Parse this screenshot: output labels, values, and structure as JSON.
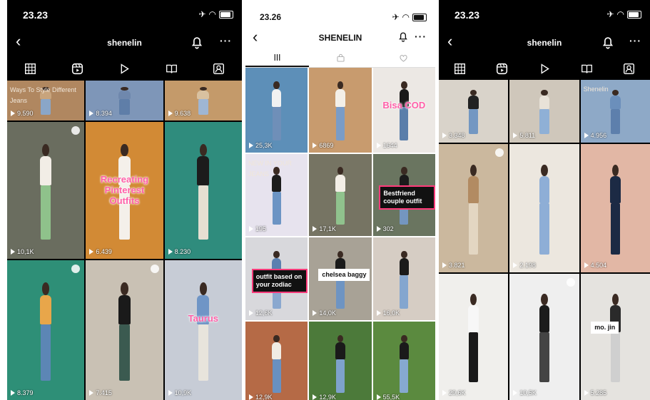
{
  "screens": [
    {
      "theme": "dark",
      "time": "23.23",
      "username": "shenelin",
      "tabs": [
        "grid-icon",
        "reels-icon",
        "play-icon",
        "guide-icon",
        "tagged-icon"
      ],
      "active_tab": 1,
      "tiles": [
        {
          "views": "9.590",
          "bg": "#b08760",
          "top": "#c8a47c",
          "legs": "#8aa6c8",
          "caption": "Ways To Style Different Jeans",
          "cap_style": "top"
        },
        {
          "views": "8.394",
          "bg": "#7e96b8",
          "top": "#6f88ad",
          "legs": "#5f7ea8"
        },
        {
          "views": "9.638",
          "bg": "#c49a6a",
          "top": "#d9c1a0",
          "legs": "#9fb6d3"
        },
        {
          "views": "10,1K",
          "bg": "#6a6d5f",
          "top": "#f2ede6",
          "legs": "#8fc28b",
          "pin": true
        },
        {
          "views": "6.439",
          "bg": "#d28a35",
          "top": "#f4f0ea",
          "legs": "#f4f0ea",
          "caption": "Recreating Pinterest Outfits",
          "cap_style": "pink"
        },
        {
          "views": "8.230",
          "bg": "#2f8c7d",
          "top": "#1c1c1c",
          "legs": "#e6dfd2"
        },
        {
          "views": "8.379",
          "bg": "#2e8f77",
          "top": "#e8a64a",
          "legs": "#5c86b5",
          "pin": true
        },
        {
          "views": "7.415",
          "bg": "#c9c1b4",
          "top": "#1a1a1a",
          "legs": "#3b5a50",
          "pin": true
        },
        {
          "views": "10,9K",
          "bg": "#c7ccd6",
          "top": "#6f95c6",
          "legs": "#e8e4dc",
          "caption": "Taurus",
          "cap_style": "pink"
        }
      ]
    },
    {
      "theme": "light",
      "time": "23.26",
      "username": "SHENELIN",
      "tabs": [
        "grid-icon",
        "shop-icon",
        "heart-icon"
      ],
      "active_tab": 0,
      "tiles": [
        {
          "views": "25,3K",
          "bg": "#5d8fb8",
          "top": "#f1f1f1",
          "legs": "#6f8fb8"
        },
        {
          "views": "6869",
          "bg": "#c89b6e",
          "top": "#f3efe8",
          "legs": "#7a9cc7"
        },
        {
          "views": "1644",
          "bg": "#ece8e4",
          "top": "#1a1a1a",
          "legs": "#5a7eaa",
          "caption": "Bisa COD",
          "cap_style": "pink"
        },
        {
          "views": "195",
          "bg": "#e7e3ee",
          "top": "#1c1c1c",
          "legs": "#6c94c4",
          "caption": "NEW IN YOUR JEANS",
          "cap_style": "top"
        },
        {
          "views": "17,1K",
          "bg": "#767463",
          "top": "#f3eee6",
          "legs": "#90c28d"
        },
        {
          "views": "302",
          "bg": "#6a7560",
          "top": "#1b1b1b",
          "legs": "#7496c0",
          "caption": "Bestfriend couple outfit",
          "cap_style": "box"
        },
        {
          "views": "12,6K",
          "bg": "#d8d8dc",
          "top": "#5a80b0",
          "legs": "#8aa8cf",
          "caption": "outfit based on your zodiac",
          "cap_style": "box"
        },
        {
          "views": "14,0K",
          "bg": "#a8a296",
          "top": "#1a1a1a",
          "legs": "#6e94c2",
          "caption": "chelsea baggy",
          "cap_style": "white"
        },
        {
          "views": "16,0K",
          "bg": "#d6cdc4",
          "top": "#1a1a1a",
          "legs": "#84a6cf"
        },
        {
          "views": "12,9K",
          "bg": "#b56a46",
          "top": "#f1ece4",
          "legs": "#6990c0"
        },
        {
          "views": "12,9K",
          "bg": "#4c7a3a",
          "top": "#1a1a1a",
          "legs": "#7ea2cc"
        },
        {
          "views": "55,5K",
          "bg": "#5b8a3f",
          "top": "#1a1a1a",
          "legs": "#86a9d0"
        }
      ]
    },
    {
      "theme": "dark",
      "time": "23.23",
      "username": "shenelin",
      "tabs": [
        "grid-icon",
        "reels-icon",
        "play-icon",
        "guide-icon",
        "tagged-icon"
      ],
      "active_tab": 1,
      "tiles": [
        {
          "views": "3.348",
          "bg": "#d9d3ca",
          "top": "#222222",
          "legs": "#7397c2"
        },
        {
          "views": "5.811",
          "bg": "#cfc7bb",
          "top": "#e8e2d8",
          "legs": "#8fb0d6"
        },
        {
          "views": "4.956",
          "bg": "#8ea9c7",
          "top": "#6b8fbb",
          "legs": "#5d7fac",
          "caption": "Shenelin",
          "cap_style": "top"
        },
        {
          "views": "3.821",
          "bg": "#cbb89e",
          "top": "#b28b62",
          "legs": "#e3d6c2",
          "pin": true
        },
        {
          "views": "2.198",
          "bg": "#ece7df",
          "top": "#8eaed6",
          "legs": "#8eaed6"
        },
        {
          "views": "4.504",
          "bg": "#e2b7a5",
          "top": "#1c2a44",
          "legs": "#1c2a44"
        },
        {
          "views": "29,6K",
          "bg": "#f0efec",
          "top": "#f7f7f7",
          "legs": "#1a1a1a"
        },
        {
          "views": "10,5K",
          "bg": "#efefef",
          "top": "#1b1b1b",
          "legs": "#444444",
          "pin": true
        },
        {
          "views": "5.285",
          "bg": "#e5e3df",
          "top": "#2a2a2a",
          "legs": "#cfcfcf",
          "caption": "mo. jin",
          "cap_style": "white"
        }
      ]
    }
  ]
}
